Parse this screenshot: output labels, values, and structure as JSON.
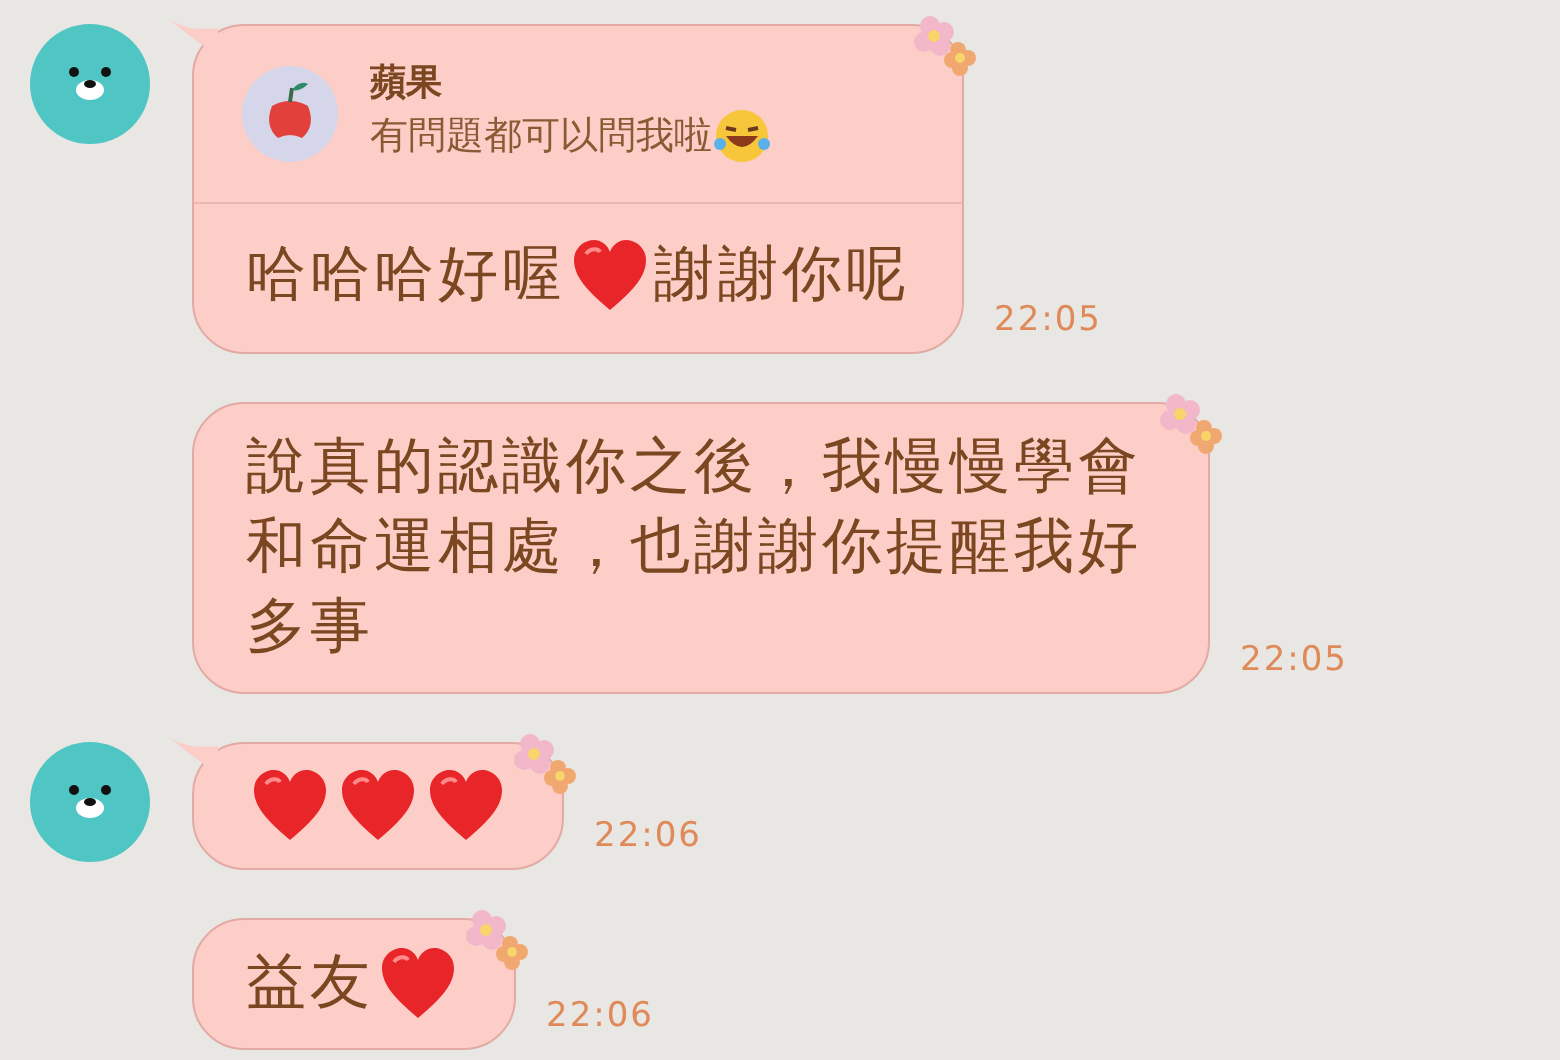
{
  "messages": [
    {
      "avatar": true,
      "reply": {
        "name": "蘋果",
        "parts": [
          {
            "kind": "text",
            "text": "有問題都可以問我啦"
          },
          {
            "kind": "laugh"
          }
        ]
      },
      "parts": [
        {
          "kind": "text",
          "text": "哈哈哈好喔"
        },
        {
          "kind": "heart"
        },
        {
          "kind": "text",
          "text": "謝謝你呢"
        }
      ],
      "time": "22:05"
    },
    {
      "avatar": false,
      "parts": [
        {
          "kind": "text",
          "text": "說真的認識你之後，我慢慢學會和命運相處，也謝謝你提醒我好多事"
        }
      ],
      "time": "22:05"
    },
    {
      "avatar": true,
      "parts": [
        {
          "kind": "heart"
        },
        {
          "kind": "heart"
        },
        {
          "kind": "heart"
        }
      ],
      "time": "22:06"
    },
    {
      "avatar": false,
      "parts": [
        {
          "kind": "text",
          "text": "益友"
        },
        {
          "kind": "heart"
        }
      ],
      "time": "22:06"
    }
  ]
}
